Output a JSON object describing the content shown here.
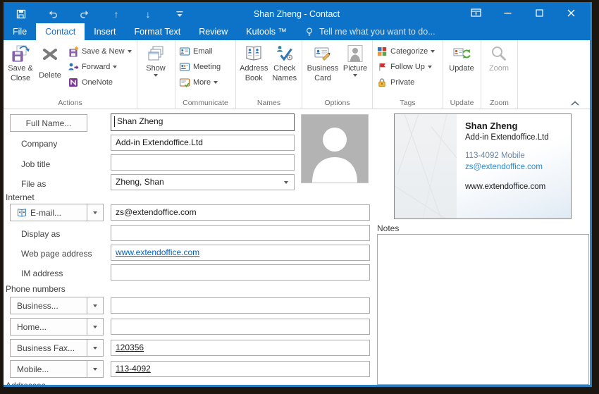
{
  "window": {
    "title": "Shan Zheng - Contact"
  },
  "qat": {
    "move_up_glyph": "↑",
    "move_down_glyph": "↓"
  },
  "tabs": {
    "file": "File",
    "contact": "Contact",
    "insert": "Insert",
    "format_text": "Format Text",
    "review": "Review",
    "kutools": "Kutools ™",
    "tell_me": "Tell me what you want to do..."
  },
  "ribbon": {
    "actions": {
      "save_close_line1": "Save &",
      "save_close_line2": "Close",
      "delete": "Delete",
      "save_new": "Save & New",
      "forward": "Forward",
      "onenote": "OneNote",
      "group_label": "Actions"
    },
    "show": {
      "button": "Show"
    },
    "communicate": {
      "email": "Email",
      "meeting": "Meeting",
      "more": "More",
      "group_label": "Communicate"
    },
    "names": {
      "address_book_line1": "Address",
      "address_book_line2": "Book",
      "check_names_line1": "Check",
      "check_names_line2": "Names",
      "group_label": "Names"
    },
    "options": {
      "business_card_line1": "Business",
      "business_card_line2": "Card",
      "picture": "Picture",
      "group_label": "Options"
    },
    "tags": {
      "categorize": "Categorize",
      "follow_up": "Follow Up",
      "private": "Private",
      "group_label": "Tags"
    },
    "update": {
      "button": "Update",
      "group_label": "Update"
    },
    "zoom": {
      "button": "Zoom",
      "group_label": "Zoom"
    }
  },
  "form": {
    "full_name": {
      "button": "Full Name...",
      "value": "Shan Zheng"
    },
    "company": {
      "label": "Company",
      "value": "Add-in Extendoffice.Ltd"
    },
    "job_title": {
      "label": "Job title",
      "value": ""
    },
    "file_as": {
      "label": "File as",
      "value": "Zheng, Shan"
    },
    "internet_header": "Internet",
    "email": {
      "button": "E-mail...",
      "value": "zs@extendoffice.com"
    },
    "display_as": {
      "label": "Display as",
      "value": ""
    },
    "web_page": {
      "label": "Web page address",
      "value": "www.extendoffice.com"
    },
    "im_address": {
      "label": "IM address",
      "value": ""
    },
    "phone_header": "Phone numbers",
    "phones": [
      {
        "button": "Business...",
        "value": ""
      },
      {
        "button": "Home...",
        "value": ""
      },
      {
        "button": "Business Fax...",
        "value": "120356"
      },
      {
        "button": "Mobile...",
        "value": "113-4092"
      }
    ],
    "addresses_header": "Addresses",
    "notes_label": "Notes"
  },
  "business_card": {
    "name": "Shan Zheng",
    "company": "Add-in Extendoffice.Ltd",
    "mobile": "113-4092 Mobile",
    "email": "zs@extendoffice.com",
    "website": "www.extendoffice.com"
  },
  "colors": {
    "titlebar": "#0d73c8",
    "active_tab_text": "#1b6cbe",
    "link": "#0563c1",
    "card_email": "#2a8bd5",
    "flag_red": "#cf2e2e"
  }
}
